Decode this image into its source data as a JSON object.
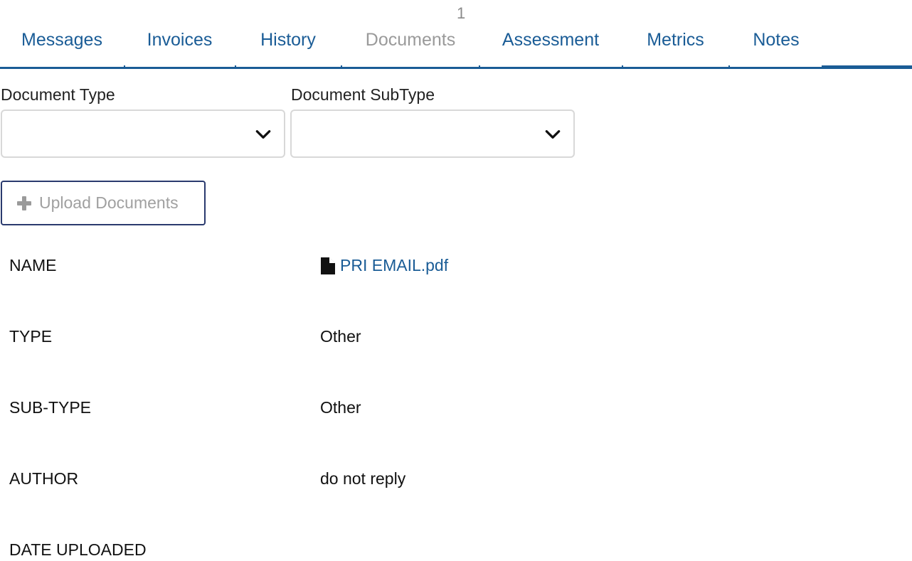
{
  "pagination": {
    "count": "1"
  },
  "tabs": [
    {
      "label": "Messages",
      "disabled": false
    },
    {
      "label": "Invoices",
      "disabled": false
    },
    {
      "label": "History",
      "disabled": false
    },
    {
      "label": "Documents",
      "disabled": true
    },
    {
      "label": "Assessment",
      "disabled": false
    },
    {
      "label": "Metrics",
      "disabled": false
    },
    {
      "label": "Notes",
      "disabled": false
    }
  ],
  "filters": {
    "document_type": {
      "label": "Document Type",
      "value": ""
    },
    "document_subtype": {
      "label": "Document SubType",
      "value": ""
    }
  },
  "upload": {
    "label": "Upload Documents",
    "icon": "plus-icon"
  },
  "document": {
    "name_label": "NAME",
    "name_value": "PRI EMAIL.pdf",
    "name_icon": "file-icon",
    "type_label": "TYPE",
    "type_value": "Other",
    "subtype_label": "SUB-TYPE",
    "subtype_value": "Other",
    "author_label": "AUTHOR",
    "author_value": "do not reply",
    "date_label": "DATE UPLOADED",
    "date_value": ""
  },
  "colors": {
    "accent": "#1a5c96",
    "disabled_text": "#9a9a9a",
    "button_border": "#2a3a6e"
  }
}
